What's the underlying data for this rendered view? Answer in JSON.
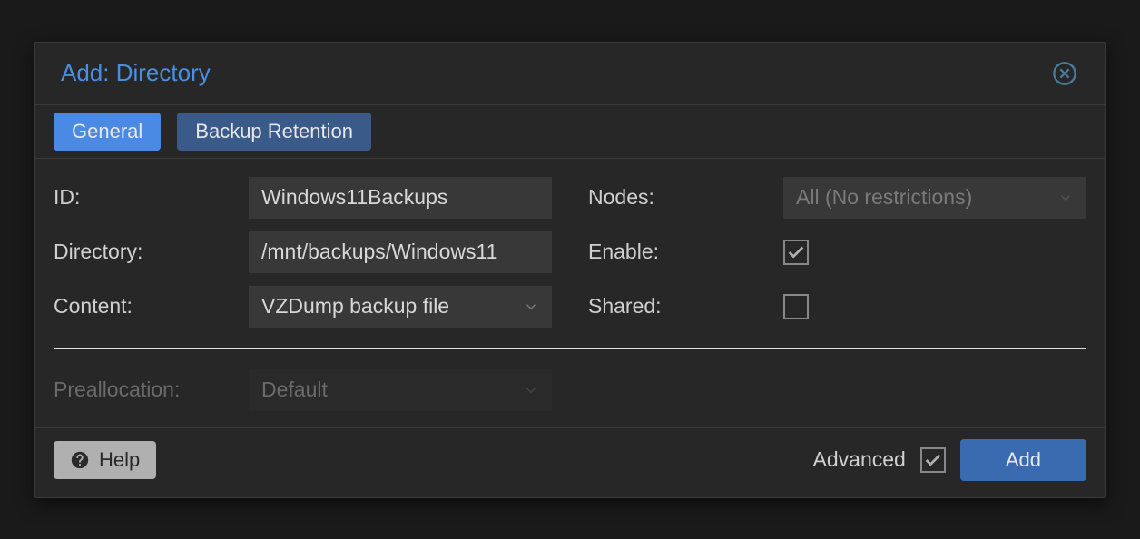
{
  "dialog": {
    "title": "Add: Directory"
  },
  "tabs": [
    {
      "label": "General",
      "active": true
    },
    {
      "label": "Backup Retention",
      "active": false
    }
  ],
  "form": {
    "id_label": "ID:",
    "id_value": "Windows11Backups",
    "directory_label": "Directory:",
    "directory_value": "/mnt/backups/Windows11",
    "content_label": "Content:",
    "content_value": "VZDump backup file",
    "nodes_label": "Nodes:",
    "nodes_placeholder": "All (No restrictions)",
    "enable_label": "Enable:",
    "enable_checked": true,
    "shared_label": "Shared:",
    "shared_checked": false,
    "preallocation_label": "Preallocation:",
    "preallocation_value": "Default"
  },
  "footer": {
    "help_label": "Help",
    "advanced_label": "Advanced",
    "advanced_checked": true,
    "add_label": "Add"
  }
}
